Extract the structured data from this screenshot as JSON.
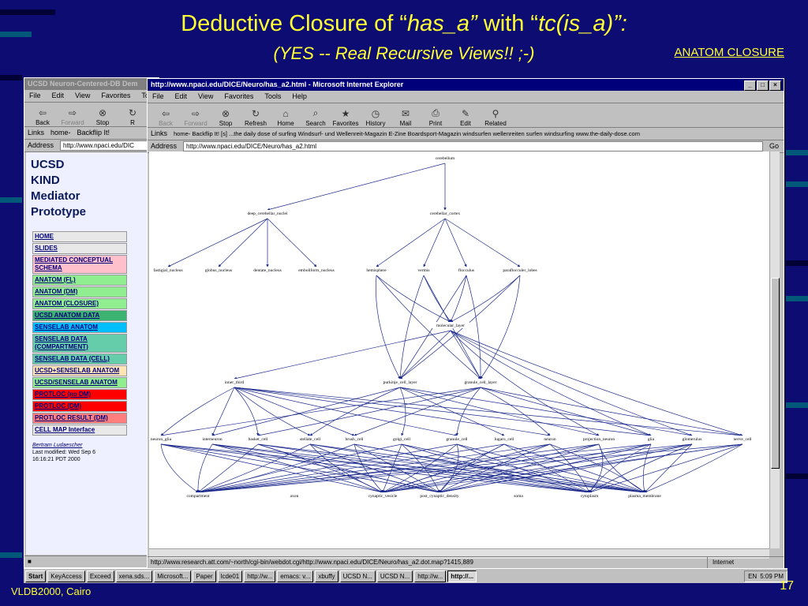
{
  "slide": {
    "title_main": "Deductive Closure of “",
    "title_has_a": "has_a”",
    "title_with": " with “",
    "title_tc": "tc(is_a)”:",
    "subtitle": "(YES -- Real Recursive Views!! ;-)",
    "link_closure": "ANATOM CLOSURE",
    "footer": "VLDB2000, Cairo",
    "slide_number": "17"
  },
  "back_window": {
    "title": "UCSD Neuron-Centered-DB Dem",
    "menu": [
      "File",
      "Edit",
      "View",
      "Favorites",
      "Too"
    ],
    "toolbar": [
      "Back",
      "Forward",
      "Stop",
      "R"
    ],
    "links_label": "Links",
    "links": [
      "home-",
      "Backflip It!"
    ],
    "address_label": "Address",
    "address": "http://www.npaci.edu/DIC",
    "side_title": [
      "UCSD",
      "KIND",
      "Mediator",
      "Prototype"
    ],
    "nav": [
      {
        "label": "HOME",
        "bg": "#e8e8e8"
      },
      {
        "label": "SLIDES",
        "bg": "#e8e8e8"
      },
      {
        "label": "MEDIATED CONCEPTUAL SCHEMA",
        "bg": "#ffc0cb"
      },
      {
        "label": "ANATOM (FL)",
        "bg": "#90ee90"
      },
      {
        "label": "ANATOM (DM)",
        "bg": "#90ee90"
      },
      {
        "label": "ANATOM (CLOSURE)",
        "bg": "#90ee90"
      },
      {
        "label": "UCSD ANATOM DATA",
        "bg": "#3cb371"
      },
      {
        "label": "SENSELAB ANATOM",
        "bg": "#00bfff"
      },
      {
        "label": "SENSELAB DATA (COMPARTMENT)",
        "bg": "#66cdaa"
      },
      {
        "label": "SENSELAB DATA (CELL)",
        "bg": "#66cdaa"
      },
      {
        "label": "UCSD+SENSELAB ANATOM",
        "bg": "#ffe4b5"
      },
      {
        "label": "UCSD/SENSELAB ANATOM",
        "bg": "#90ee90"
      },
      {
        "label": "PROTLOC (no DM)",
        "bg": "#ff0000"
      },
      {
        "label": "PROTLOC (DM)",
        "bg": "#ff0000"
      },
      {
        "label": "PROTLOC RESULT (DM)",
        "bg": "#ff7f7f"
      },
      {
        "label": "CELL MAP Interface",
        "bg": "#e8e8e8"
      }
    ],
    "author": "Bertram Ludaescher",
    "modified": "Last modified: Wed Sep 6",
    "modified2": "16:16:21 PDT 2000"
  },
  "front_window": {
    "title": "http://www.npaci.edu/DICE/Neuro/has_a2.html - Microsoft Internet Explorer",
    "menu": [
      "File",
      "Edit",
      "View",
      "Favorites",
      "Tools",
      "Help"
    ],
    "toolbar": [
      {
        "label": "Back",
        "icon": "back-arrow-icon",
        "glyph": "⇦",
        "disabled": true
      },
      {
        "label": "Forward",
        "icon": "forward-arrow-icon",
        "glyph": "⇨",
        "disabled": true
      },
      {
        "label": "Stop",
        "icon": "stop-icon",
        "glyph": "⊗",
        "disabled": false
      },
      {
        "label": "Refresh",
        "icon": "refresh-icon",
        "glyph": "↻",
        "disabled": false
      },
      {
        "label": "Home",
        "icon": "home-icon",
        "glyph": "⌂",
        "disabled": false
      },
      {
        "label": "Search",
        "icon": "search-icon",
        "glyph": "⌕",
        "disabled": false
      },
      {
        "label": "Favorites",
        "icon": "favorites-icon",
        "glyph": "★",
        "disabled": false
      },
      {
        "label": "History",
        "icon": "history-icon",
        "glyph": "◷",
        "disabled": false
      },
      {
        "label": "Mail",
        "icon": "mail-icon",
        "glyph": "✉",
        "disabled": false
      },
      {
        "label": "Print",
        "icon": "print-icon",
        "glyph": "⎙",
        "disabled": false
      },
      {
        "label": "Edit",
        "icon": "edit-icon",
        "glyph": "✎",
        "disabled": false
      },
      {
        "label": "Related",
        "icon": "related-icon",
        "glyph": "⚲",
        "disabled": false
      }
    ],
    "links_label": "Links",
    "links": "home-   Backflip It!   [s] ...the daily dose of surfing  Windsurf- und Wellenreit-Magazin  E-Zine  Boardsport-Magazin  windsurfen wellenreiten surfen windsurfing www.the-daily-dose.com",
    "address_label": "Address",
    "address": "http://www.npaci.edu/DICE/Neuro/has_a2.html",
    "go": "Go",
    "status_url": "http://www.research.att.com/~north/cgi-bin/webdot.cgi/http://www.npaci.edu/DICE/Neuro/has_a2.dot.map?1415,889",
    "status_zone": "Internet",
    "graph": {
      "root": "cerebellum",
      "level1": [
        "deep_cerebellar_nuclei",
        "cerebellar_cortex"
      ],
      "level2": [
        "fastigial_nucleus",
        "globus_nucleus",
        "dentate_nucleus",
        "emboliform_nucleus",
        "hemisphere",
        "vermis",
        "flocculus",
        "paraflocculer_lobes"
      ],
      "level3": [
        "molecular_layer"
      ],
      "level4": [
        "inner_third",
        "purkinje_cell_layer",
        "granule_cell_layer"
      ],
      "level5": [
        "neuron_glia",
        "interneuron",
        "basket_cell",
        "stellate_cell",
        "brush_cell",
        "golgi_cell",
        "granule_cell",
        "lugaro_cell",
        "neuron",
        "projection_neuron",
        "glia",
        "glomerulus",
        "nerve_cell"
      ],
      "level6": [
        "compartment",
        "axon",
        "cynaptic_vesicle",
        "post_cynaptic_density",
        "soma",
        "cytoplasm",
        "plasma_membrane"
      ]
    }
  },
  "taskbar": {
    "start": "Start",
    "tasks": [
      "KeyAccess",
      "Exceed",
      "xena.sds...",
      "Microsoft...",
      "Paper",
      "lcde01",
      "http://w...",
      "emacs: v...",
      "xbuffy",
      "UCSD N...",
      "UCSD N...",
      "http://w...",
      "http://..."
    ],
    "active_task": "http://...",
    "clock": "5:09 PM",
    "lang": "EN"
  }
}
